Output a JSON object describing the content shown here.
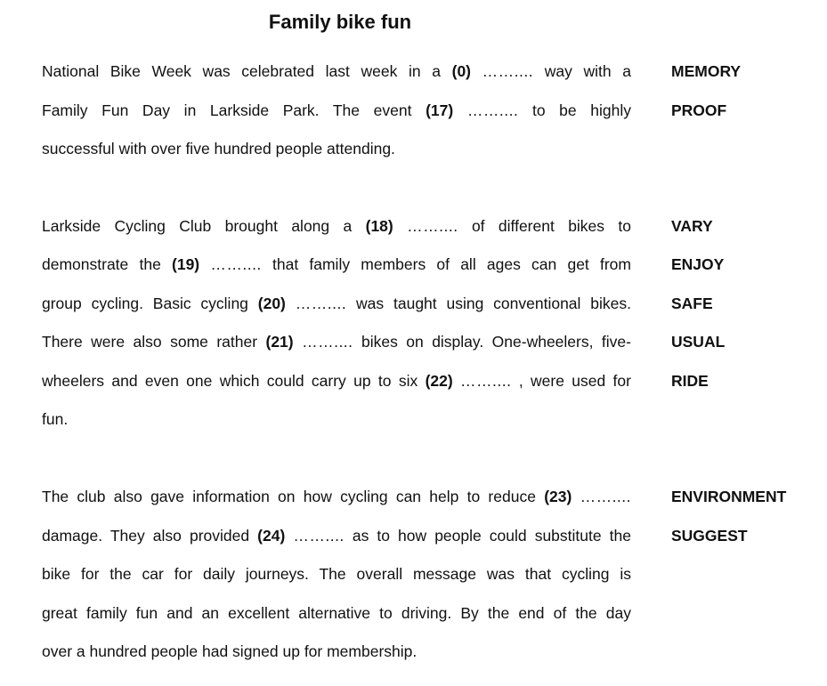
{
  "title": "Family bike fun",
  "paragraphs": [
    {
      "lines": [
        {
          "before": "National Bike Week was celebrated last week in a",
          "gap": "(0)",
          "dots": "……....",
          "after": "way with a",
          "justify": true
        },
        {
          "before": "Family Fun Day in Larkside Park. The event",
          "gap": "(17)",
          "dots": "……....",
          "after": "to be highly",
          "justify": true
        },
        {
          "before": "successful with over five hundred people attending.",
          "justify": false
        }
      ]
    },
    {
      "lines": [
        {
          "before": "Larkside Cycling Club brought along a",
          "gap": "(18)",
          "dots": "……....",
          "after": "of different bikes to",
          "justify": true
        },
        {
          "before": "demonstrate the",
          "gap": "(19)",
          "dots": "……....",
          "after": "that family members of all ages can get from",
          "justify": true
        },
        {
          "before": "group cycling. Basic cycling",
          "gap": "(20)",
          "dots": "……....",
          "after": "was taught using conventional bikes.",
          "justify": true
        },
        {
          "before": "There were also some rather",
          "gap": "(21)",
          "dots": "……....",
          "after": "bikes on display. One-wheelers, five-",
          "justify": true
        },
        {
          "before": "wheelers and even one which could carry up to six",
          "gap": "(22)",
          "dots": "……....",
          "after": ", were used for",
          "justify": true
        },
        {
          "before": "fun.",
          "justify": false
        }
      ]
    },
    {
      "lines": [
        {
          "before": "The club also gave information on how cycling can help to reduce",
          "gap": "(23)",
          "dots": "……....",
          "after": "",
          "justify": true
        },
        {
          "before": "damage. They also provided",
          "gap": "(24)",
          "dots": "……....",
          "after": "as to how people could substitute the",
          "justify": true
        },
        {
          "before": "bike for the car for daily journeys. The overall message was that cycling is",
          "justify": true
        },
        {
          "before": "great family fun and an excellent alternative to driving. By the end of the day",
          "justify": true
        },
        {
          "before": "over a hundred people had signed up for membership.",
          "justify": false
        }
      ]
    }
  ],
  "keywords": [
    "MEMORY",
    "PROOF",
    "VARY",
    "ENJOY",
    "SAFE",
    "USUAL",
    "RIDE",
    "ENVIRONMENT",
    "SUGGEST"
  ]
}
